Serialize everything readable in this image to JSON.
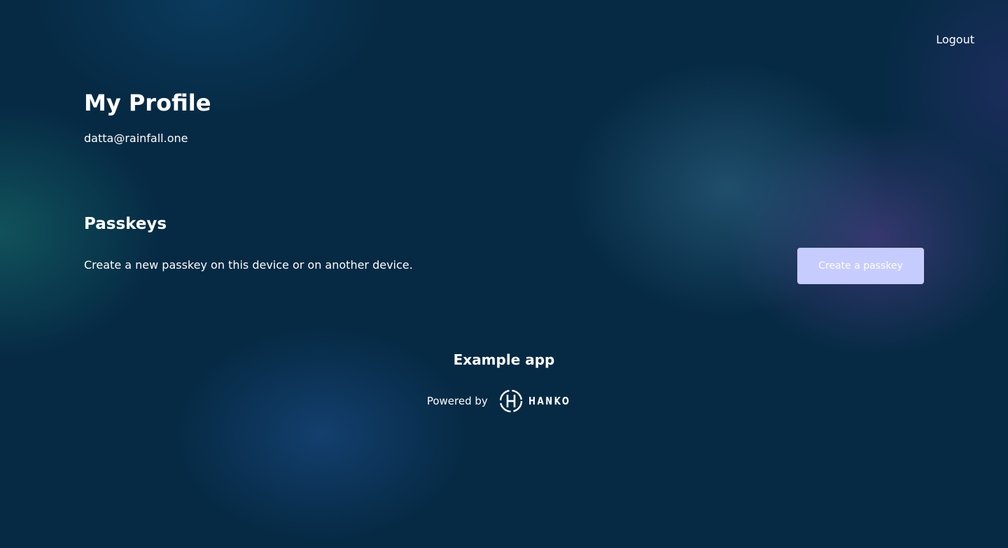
{
  "header": {
    "logout_label": "Logout"
  },
  "profile": {
    "title": "My Profile",
    "email": "datta@rainfall.one"
  },
  "passkeys": {
    "title": "Passkeys",
    "description": "Create a new passkey on this device or on another device.",
    "create_button_label": "Create a passkey"
  },
  "footer": {
    "app_name": "Example app",
    "powered_by_label": "Powered by",
    "brand_name": "HANKO"
  },
  "colors": {
    "background": "#062a44",
    "button_background": "#c7ccff",
    "text": "#ffffff"
  },
  "icons": {
    "brand_logo": "hanko-logo-icon"
  }
}
